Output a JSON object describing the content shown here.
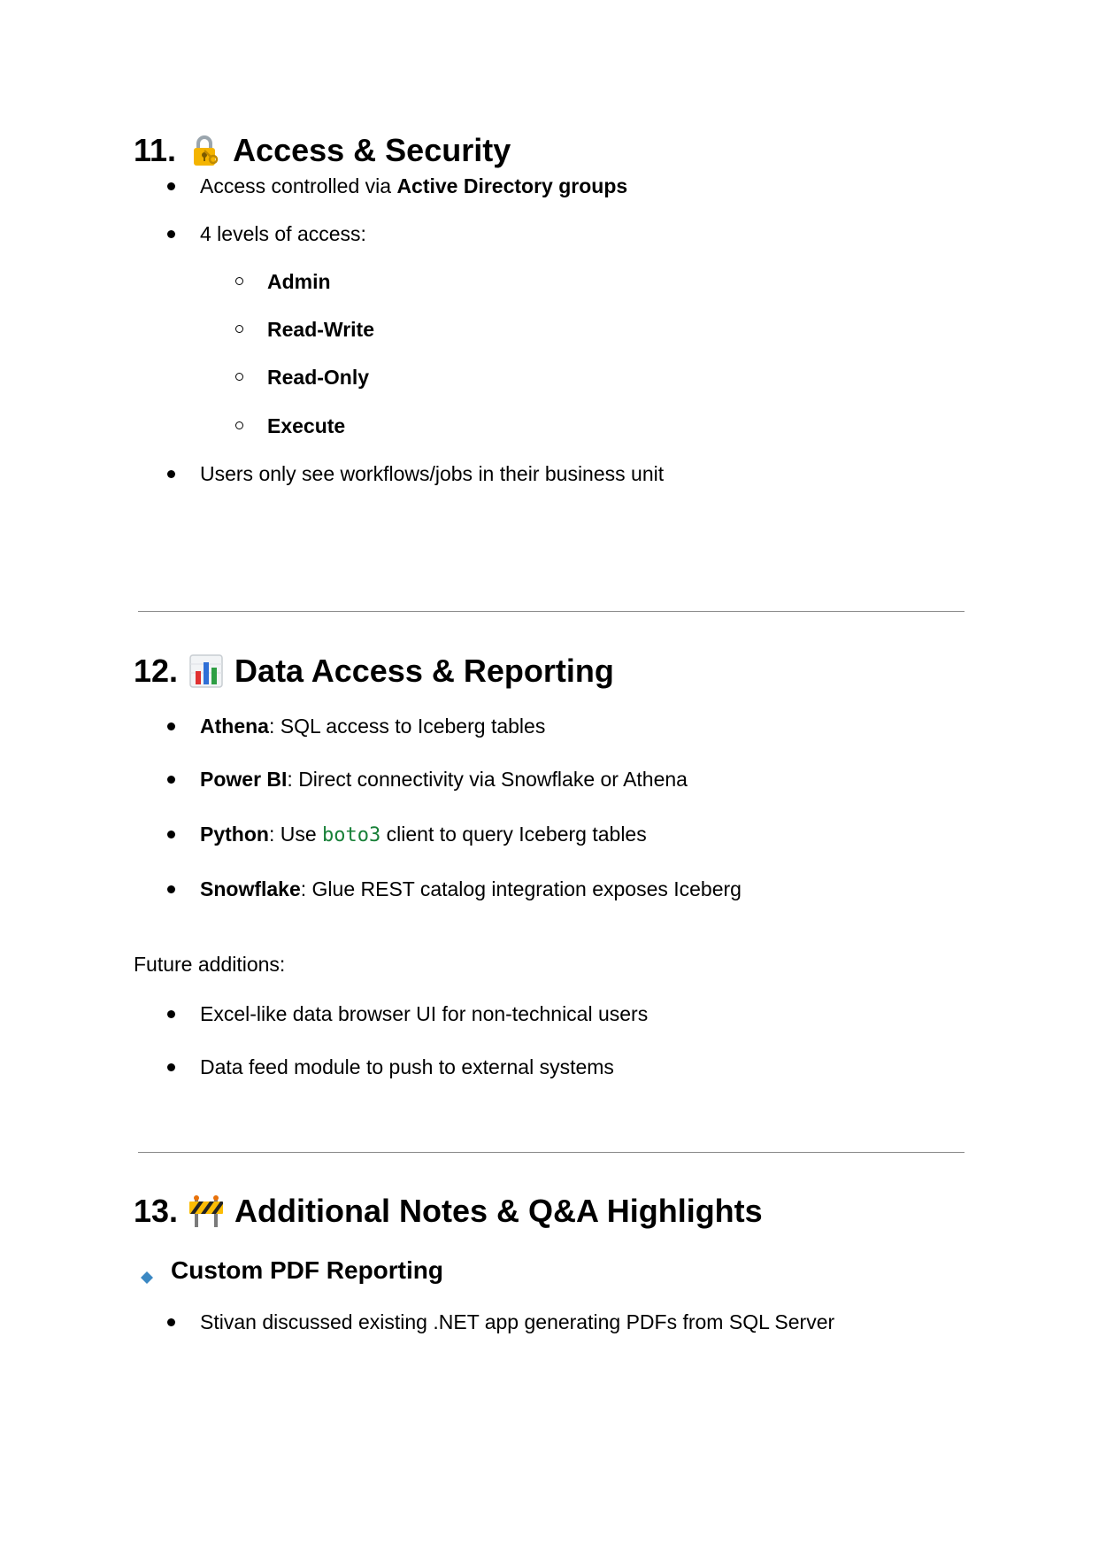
{
  "sections": [
    {
      "number": "11.",
      "icon": "locked-with-key-icon",
      "title": "Access & Security",
      "items": [
        {
          "pre": "Access controlled via ",
          "bold": "Active Directory groups"
        },
        {
          "text": "4 levels of access:"
        },
        {
          "sub": [
            "Admin",
            "Read-Write",
            "Read-Only",
            "Execute"
          ]
        },
        {
          "text": "Users only see workflows/jobs in their business unit"
        }
      ]
    },
    {
      "number": "12.",
      "icon": "bar-chart-icon",
      "title": "Data Access & Reporting",
      "items": [
        {
          "bold": "Athena",
          "rest": ": SQL access to Iceberg tables"
        },
        {
          "bold": "Power BI",
          "rest": ": Direct connectivity via Snowflake or Athena"
        },
        {
          "bold": "Python",
          "mid": ": Use ",
          "code": "boto3",
          "rest": " client to query Iceberg tables"
        },
        {
          "bold": "Snowflake",
          "rest": ": Glue REST catalog integration exposes Iceberg"
        }
      ],
      "paragraph": "Future additions:",
      "future_items": [
        "Excel-like data browser UI for non-technical users",
        "Data feed module to push to external systems"
      ]
    },
    {
      "number": "13.",
      "icon": "construction-barrier-icon",
      "title": "Additional Notes & Q&A Highlights",
      "subheading": {
        "icon": "small-blue-diamond-icon",
        "text": "Custom PDF Reporting"
      },
      "items": [
        "Stivan discussed existing .NET app generating PDFs from SQL Server"
      ]
    }
  ],
  "colors": {
    "code": "#188038",
    "rule": "#888888",
    "diamond": "#3b88c3",
    "lock": "#f4b400",
    "barrier": "#fbbc05"
  }
}
